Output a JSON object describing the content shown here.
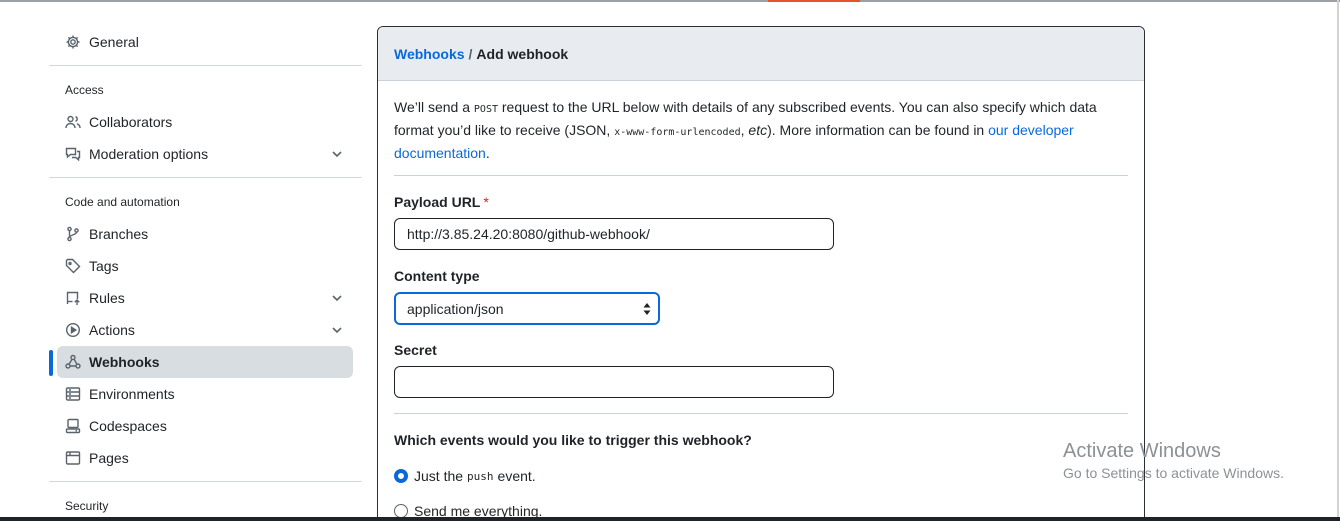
{
  "sidebar": {
    "general": "General",
    "access_heading": "Access",
    "collaborators": "Collaborators",
    "moderation": "Moderation options",
    "code_heading": "Code and automation",
    "branches": "Branches",
    "tags": "Tags",
    "rules": "Rules",
    "actions": "Actions",
    "webhooks": "Webhooks",
    "environments": "Environments",
    "codespaces": "Codespaces",
    "pages": "Pages",
    "security_heading": "Security"
  },
  "breadcrumb": {
    "parent": "Webhooks",
    "separator": "/",
    "current": "Add webhook"
  },
  "intro": {
    "p1": "We’ll send a ",
    "method": "POST",
    "p2": " request to the URL below with details of any subscribed events. You can also specify which data format you’d like to receive (JSON, ",
    "format": "x-www-form-urlencoded",
    "p3": ", ",
    "etc": "etc",
    "p4": "). More information can be found in ",
    "link": "our developer documentation",
    "p5": "."
  },
  "form": {
    "payload_label": "Payload URL",
    "required_mark": "*",
    "payload_value": "http://3.85.24.20:8080/github-webhook/",
    "content_type_label": "Content type",
    "content_type_value": "application/json",
    "secret_label": "Secret",
    "secret_value": "",
    "events_question": "Which events would you like to trigger this webhook?",
    "option_push_pre": "Just the",
    "option_push_code": "push",
    "option_push_post": "event.",
    "option_everything": "Send me everything."
  },
  "watermark": {
    "line1": "Activate Windows",
    "line2": "Go to Settings to activate Windows."
  },
  "colors": {
    "accent": "#0969da",
    "active_bg": "#d8dde2",
    "header_bg": "#e8ecf0",
    "required": "#d1242f"
  }
}
